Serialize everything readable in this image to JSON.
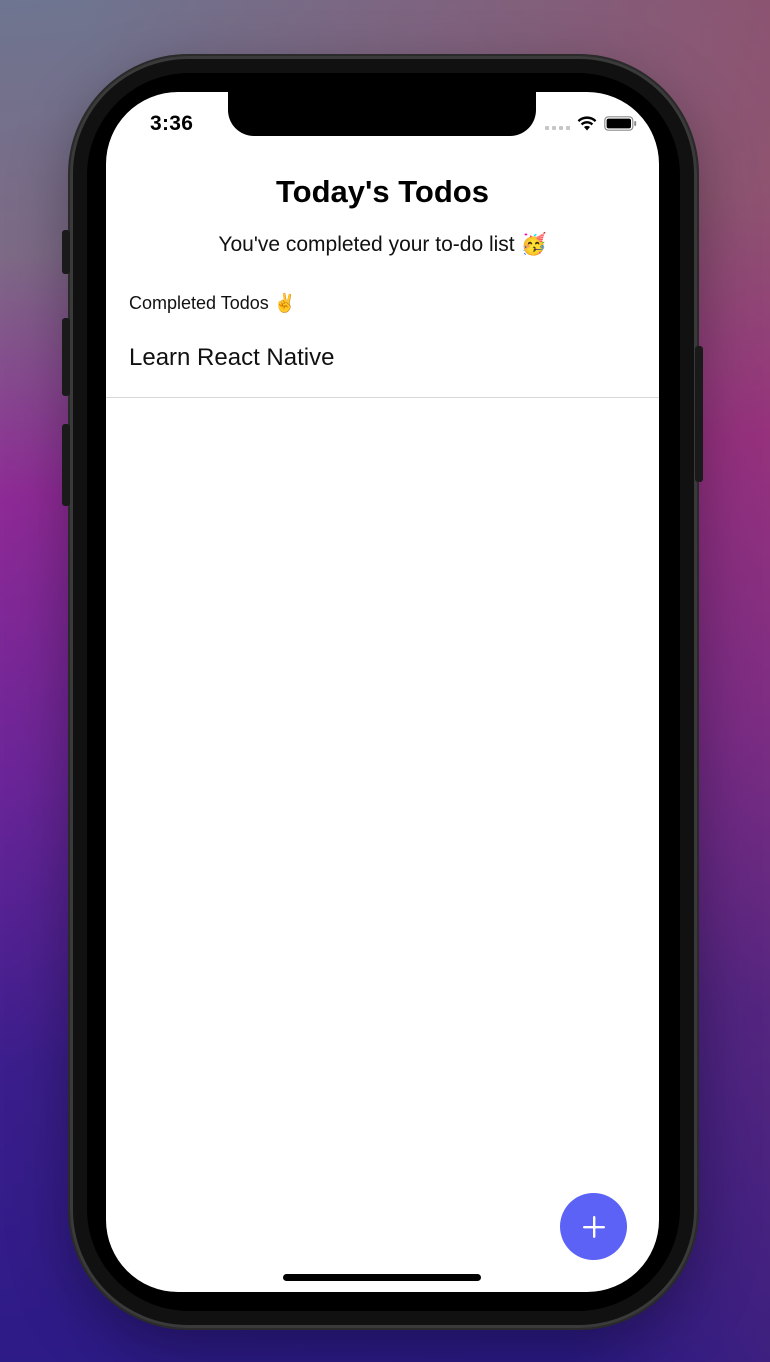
{
  "status_bar": {
    "time": "3:36"
  },
  "header": {
    "title": "Today's Todos",
    "subtitle": "You've completed your to-do list 🥳"
  },
  "sections": [
    {
      "label": "Completed Todos ✌️",
      "items": [
        {
          "text": "Learn React Native"
        }
      ]
    }
  ],
  "fab": {
    "icon": "plus-icon",
    "color": "#5b62f5"
  },
  "icons": {
    "wifi": "wifi-icon",
    "battery": "battery-icon",
    "signal": "cellular-signal-icon"
  }
}
